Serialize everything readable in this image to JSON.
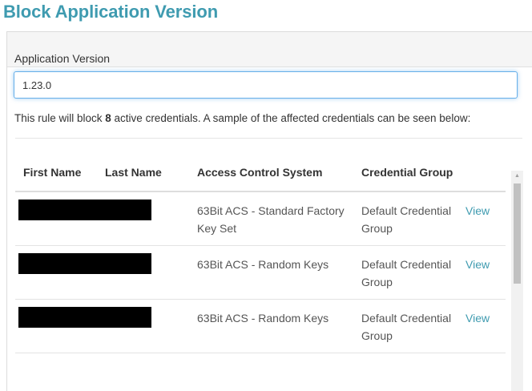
{
  "page": {
    "title": "Block Application Version"
  },
  "form": {
    "version_label": "Application Version",
    "version_value": "1.23.0"
  },
  "rule": {
    "prefix": "This rule will block ",
    "count": "8",
    "suffix": " active credentials. A sample of the affected credentials can be seen below:"
  },
  "table": {
    "headers": {
      "first_name": "First Name",
      "last_name": "Last Name",
      "acs": "Access Control System",
      "group": "Credential Group"
    },
    "rows": [
      {
        "first_name": "",
        "last_name": "",
        "acs": "63Bit ACS - Standard Factory Key Set",
        "group": "Default Credential Group",
        "action": "View"
      },
      {
        "first_name": "",
        "last_name": "",
        "acs": "63Bit ACS - Random Keys",
        "group": "Default Credential Group",
        "action": "View"
      },
      {
        "first_name": "",
        "last_name": "",
        "acs": "63Bit ACS - Random Keys",
        "group": "Default Credential Group",
        "action": "View"
      }
    ]
  },
  "colors": {
    "accent": "#3f9bb0",
    "redaction": "#000000"
  },
  "icons": {
    "scroll_up": "triangle-up-icon"
  }
}
